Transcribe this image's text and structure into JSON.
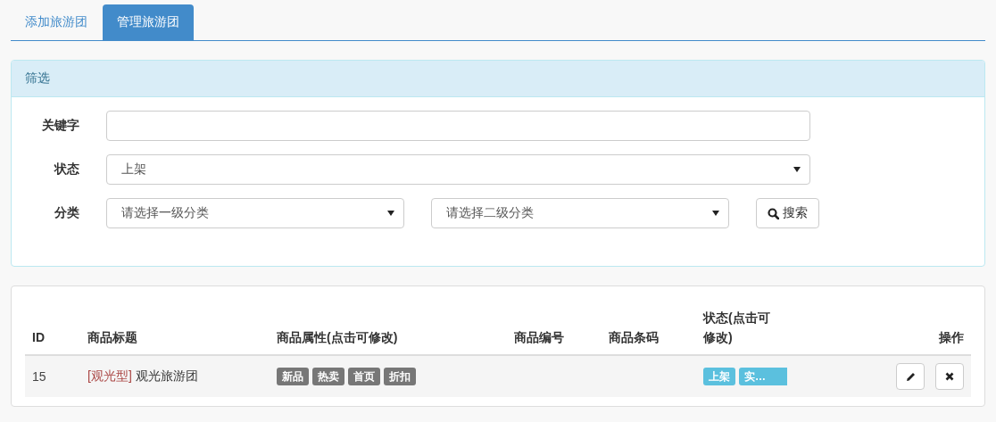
{
  "tabs": [
    {
      "label": "添加旅游团",
      "selected": false
    },
    {
      "label": "管理旅游团",
      "selected": true
    }
  ],
  "filter": {
    "title": "筛选",
    "keyword": {
      "label": "关键字"
    },
    "status": {
      "label": "状态",
      "value": "上架"
    },
    "category": {
      "label": "分类",
      "selects": [
        "请选择一级分类",
        "请选择二级分类"
      ]
    },
    "search_button": "搜索"
  },
  "table": {
    "columns": [
      "ID",
      "商品标题",
      "商品属性(点击可修改)",
      "商品编号",
      "商品条码",
      "状态(点击可修改)",
      "操作"
    ],
    "rows": [
      {
        "id": "15",
        "type": "[观光型]",
        "title": "观光旅游团",
        "attributes": [
          "新品",
          "热卖",
          "首页",
          "折扣"
        ],
        "status_tags": [
          "上架",
          "实…"
        ]
      }
    ]
  }
}
